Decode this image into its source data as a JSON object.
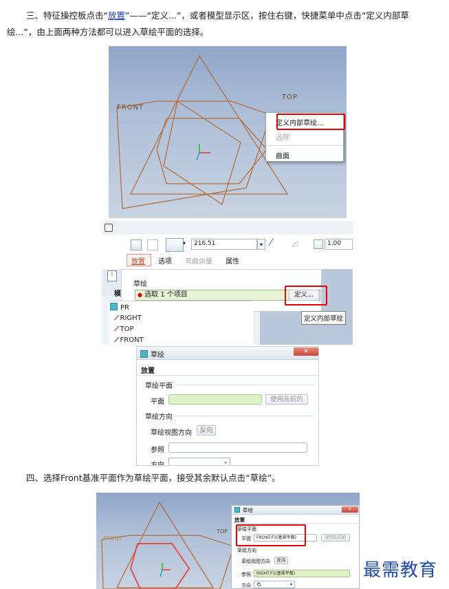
{
  "step3": {
    "part1": "三、特征操控板点击“",
    "link": "放置",
    "part2": "”——“定义...”，或者模型显示区，按住右键，快捷菜单中点击“定义内部草",
    "line2": "绘...”，由上面两种方法都可以进入草绘平面的选择。"
  },
  "viewport1": {
    "label_front": "FRONT",
    "label_top": "TOP",
    "context_menu": [
      "定义内部草绘...",
      "选除",
      "曲面"
    ]
  },
  "dashboard": {
    "value": "216.51",
    "thickness": "1.00",
    "tabs": [
      "放置",
      "选项",
      "弯曲余量",
      "属性"
    ],
    "model_tree_tab": "模型",
    "panel_title": "草绘",
    "collector": "选取 1 个项目",
    "define_button": "定义...",
    "tooltip": "定义内部草绘",
    "tree_root": "PR",
    "tree_items": [
      "RIGHT",
      "TOP",
      "FRONT"
    ]
  },
  "dialog1": {
    "title": "草绘",
    "tab": "放置",
    "section_plane": "草绘平面",
    "plane_label": "平面",
    "use_prev": "使用先前的",
    "section_orient": "草绘方向",
    "view_dir_label": "草绘视图方向",
    "reverse": "反向",
    "ref_label": "参照",
    "dir_label": "方向"
  },
  "step4": {
    "text": "四、选择Front基准平面作为草绘平面，接受其余默认点击“草绘”。"
  },
  "viewport2": {
    "label_front": "FRONT",
    "label_top": "TOP",
    "dialog_title": "草绘",
    "tab": "放置",
    "section_plane": "草绘平面",
    "plane_label": "平面",
    "plane_value": "FRONT:F3(基准平面)",
    "use_prev": "使用先前的",
    "section_orient": "草绘方向",
    "view_dir_label": "草绘视图方向",
    "reverse": "反向",
    "ref_label": "参照",
    "ref_value": "RIGHT:F1(基准平面)",
    "dir_label": "方向",
    "dir_value": "右"
  },
  "watermark": "最需教育",
  "colors": {
    "datum": "#b56d3a",
    "highlight": "#e05050",
    "red_frame": "#e00000",
    "field_green": "#dff3c6",
    "link": "#1a3fc8"
  }
}
